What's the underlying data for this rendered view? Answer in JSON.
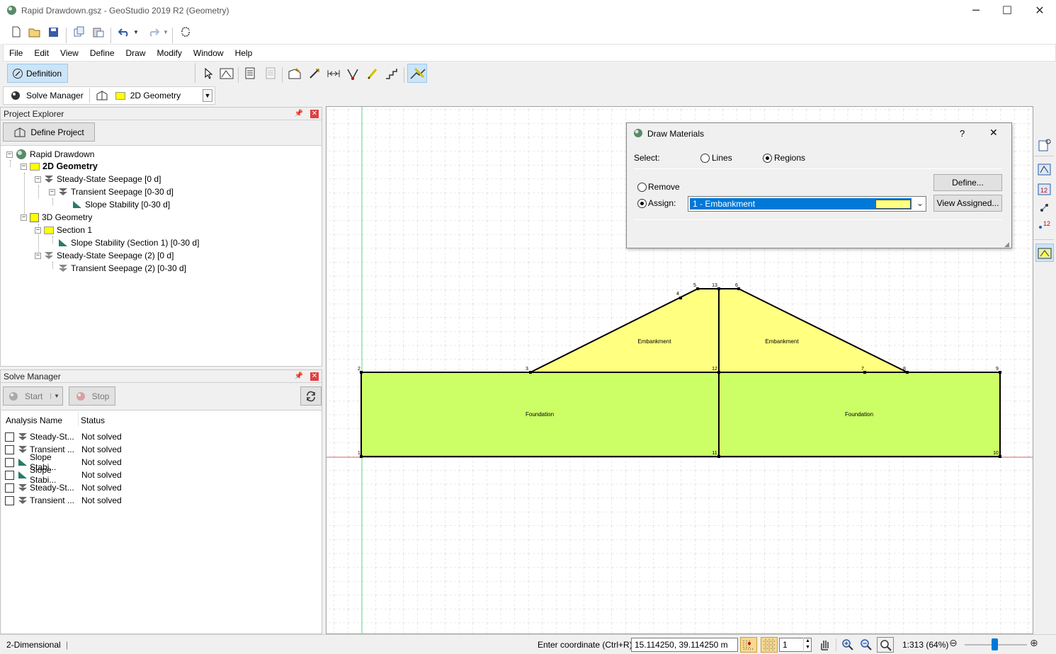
{
  "window": {
    "title": "Rapid Drawdown.gsz - GeoStudio 2019 R2 (Geometry)",
    "minimize": "─",
    "maximize": "☐",
    "close": "✕"
  },
  "toolbar_icons": [
    "new-file-icon",
    "open-folder-icon",
    "save-icon",
    "copy-icon",
    "paste-icon",
    "undo-icon",
    "redo-icon",
    "refresh-icon"
  ],
  "menu": [
    "File",
    "Edit",
    "View",
    "Define",
    "Draw",
    "Modify",
    "Window",
    "Help"
  ],
  "mode": {
    "definition": "Definition"
  },
  "solve_row": {
    "solve_manager": "Solve Manager",
    "geometry_select": "2D Geometry"
  },
  "project_explorer": {
    "title": "Project Explorer",
    "define_project": "Define Project",
    "tree": [
      {
        "label": "Rapid Drawdown",
        "icon": "globe-icon",
        "bold": false
      },
      {
        "label": "2D Geometry",
        "icon": "folder-icon",
        "bold": true
      },
      {
        "label": "Steady-State Seepage [0 d]",
        "icon": "seepage-icon"
      },
      {
        "label": "Transient Seepage [0-30 d]",
        "icon": "seepage-icon"
      },
      {
        "label": "Slope Stability [0-30 d]",
        "icon": "slope-icon"
      },
      {
        "label": "3D Geometry",
        "icon": "cube-icon"
      },
      {
        "label": "Section 1",
        "icon": "folder-icon"
      },
      {
        "label": "Slope Stability (Section 1) [0-30 d]",
        "icon": "slope-icon"
      },
      {
        "label": "Steady-State Seepage (2) [0 d]",
        "icon": "seepage-icon"
      },
      {
        "label": "Transient Seepage (2) [0-30 d]",
        "icon": "seepage-icon"
      }
    ]
  },
  "solve_manager": {
    "title": "Solve Manager",
    "start": "Start",
    "stop": "Stop",
    "columns": [
      "Analysis Name",
      "Status"
    ],
    "rows": [
      {
        "name": "Steady-St...",
        "status": "Not solved",
        "icon": "seepage-icon"
      },
      {
        "name": "Transient ...",
        "status": "Not solved",
        "icon": "seepage-icon"
      },
      {
        "name": "Slope Stabi...",
        "status": "Not solved",
        "icon": "slope-icon"
      },
      {
        "name": "Slope Stabi...",
        "status": "Not solved",
        "icon": "slope-icon"
      },
      {
        "name": "Steady-St...",
        "status": "Not solved",
        "icon": "seepage-icon"
      },
      {
        "name": "Transient ...",
        "status": "Not solved",
        "icon": "seepage-icon"
      }
    ]
  },
  "dialog": {
    "title": "Draw Materials",
    "help": "?",
    "close": "✕",
    "select_label": "Select:",
    "lines": "Lines",
    "regions": "Regions",
    "remove": "Remove",
    "assign": "Assign:",
    "material": "1 - Embankment",
    "material_color": "#ffff80",
    "define_button": "Define...",
    "view_assigned_button": "View Assigned..."
  },
  "geometry": {
    "embankment_label": "Embankment",
    "foundation_label": "Foundation",
    "points": [
      "1",
      "2",
      "3",
      "4",
      "5",
      "6",
      "7",
      "8",
      "9",
      "10",
      "11",
      "12",
      "13"
    ],
    "embankment_color": "#ffff80",
    "foundation_color": "#ccff66"
  },
  "status": {
    "mode": "2-Dimensional",
    "coord_label": "Enter coordinate (Ctrl+R):",
    "coord_value": "15.114250, 39.114250 m",
    "spin_value": "1",
    "scale": "1:313 (64%)"
  }
}
